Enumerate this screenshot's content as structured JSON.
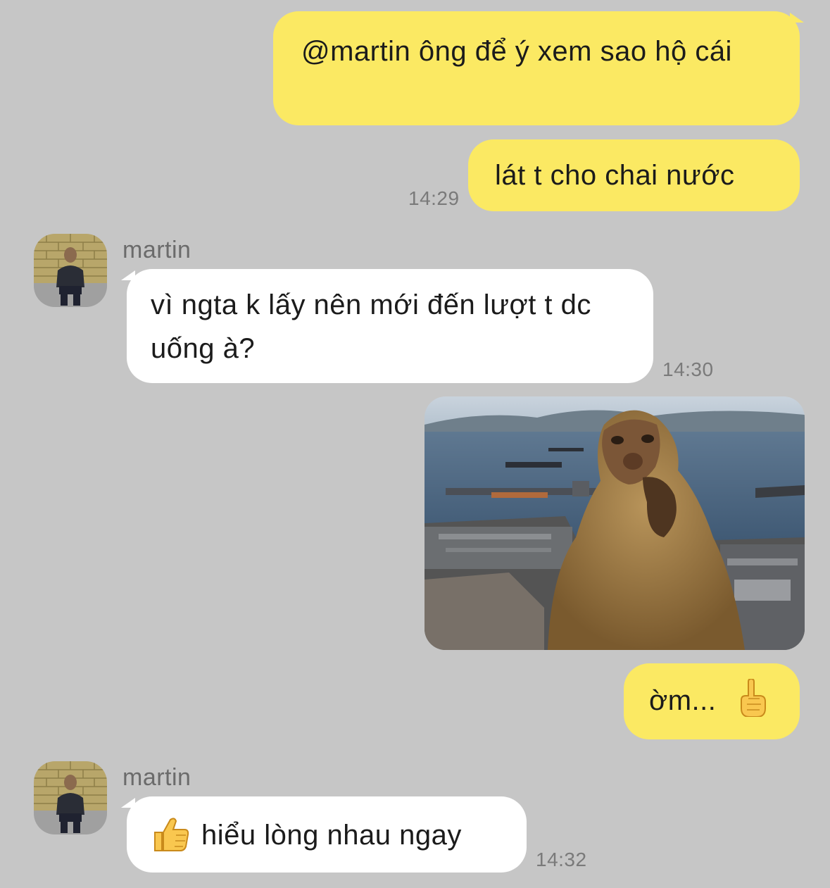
{
  "messages": [
    {
      "id": "m1",
      "direction": "outgoing",
      "text": "@martin ông để ý xem sao hộ cái"
    },
    {
      "id": "m2",
      "direction": "outgoing",
      "text": "lát t cho chai nước",
      "time": "14:29"
    },
    {
      "id": "m3",
      "direction": "incoming",
      "sender": "martin",
      "text": "vì ngta k lấy nên mới đến lượt t dc uống à?",
      "time": "14:30"
    },
    {
      "id": "m4",
      "direction": "outgoing",
      "type": "image",
      "image_subject": "thinking-monkey-harbor-photo"
    },
    {
      "id": "m5",
      "direction": "outgoing",
      "text": "ờm...",
      "emoji": "☝"
    },
    {
      "id": "m6",
      "direction": "incoming",
      "sender": "martin",
      "emoji": "👍",
      "text": "hiểu lòng nhau ngay",
      "time": "14:32"
    }
  ],
  "colors": {
    "background": "#c6c6c6",
    "outgoing_bubble": "#fbe963",
    "incoming_bubble": "#ffffff",
    "timestamp": "#7a7a7a",
    "sender_name": "#6b6b6b"
  }
}
